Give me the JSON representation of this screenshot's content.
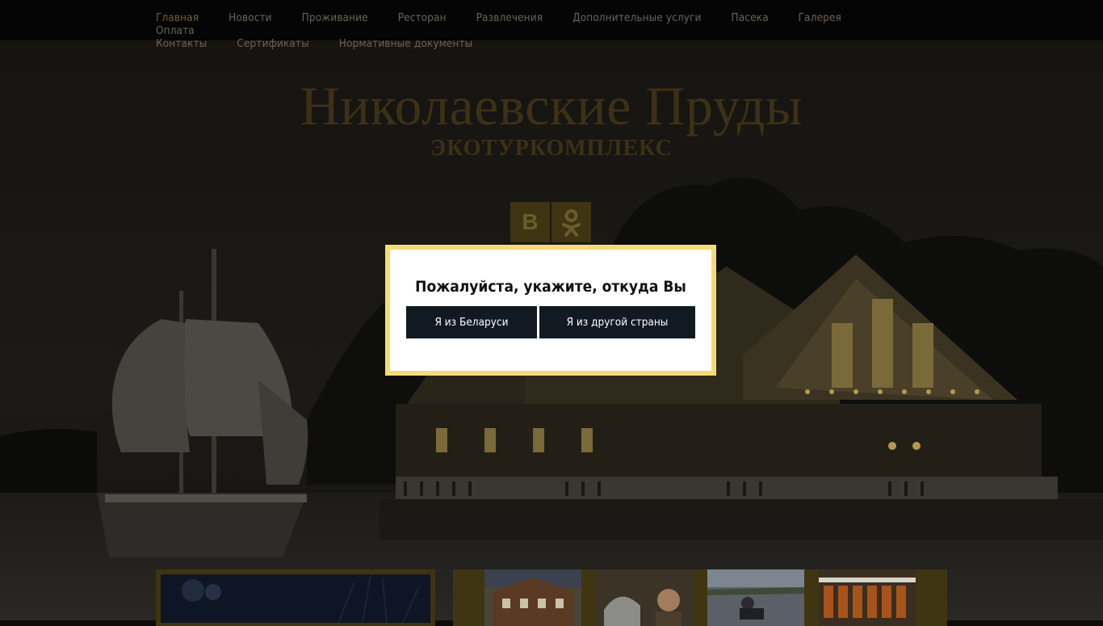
{
  "nav": {
    "items": [
      {
        "label": "Главная",
        "active": true
      },
      {
        "label": "Новости"
      },
      {
        "label": "Проживание"
      },
      {
        "label": "Ресторан"
      },
      {
        "label": "Развлечения"
      },
      {
        "label": "Дополнительные услуги"
      },
      {
        "label": "Пасека"
      },
      {
        "label": "Галерея"
      },
      {
        "label": "Оплата"
      },
      {
        "label": "Контакты"
      },
      {
        "label": "Сертификаты"
      },
      {
        "label": "Нормативные документы"
      }
    ]
  },
  "header": {
    "title": "Николаевские Пруды",
    "subtitle": "ЭКОТУРКОМПЛЕКС"
  },
  "social": {
    "vk_label": "В",
    "ok_icon": "odnoklassniki-icon"
  },
  "modal": {
    "title": "Пожалуйста, укажите, откуда Вы",
    "button_belarus": "Я из Беларуси",
    "button_other": "Я из другой страны"
  },
  "colors": {
    "nav_bg": "#050505",
    "nav_active": "#6e5f33",
    "header_text": "#3d3016",
    "modal_border": "#f3dc77",
    "modal_button": "#111a21"
  }
}
